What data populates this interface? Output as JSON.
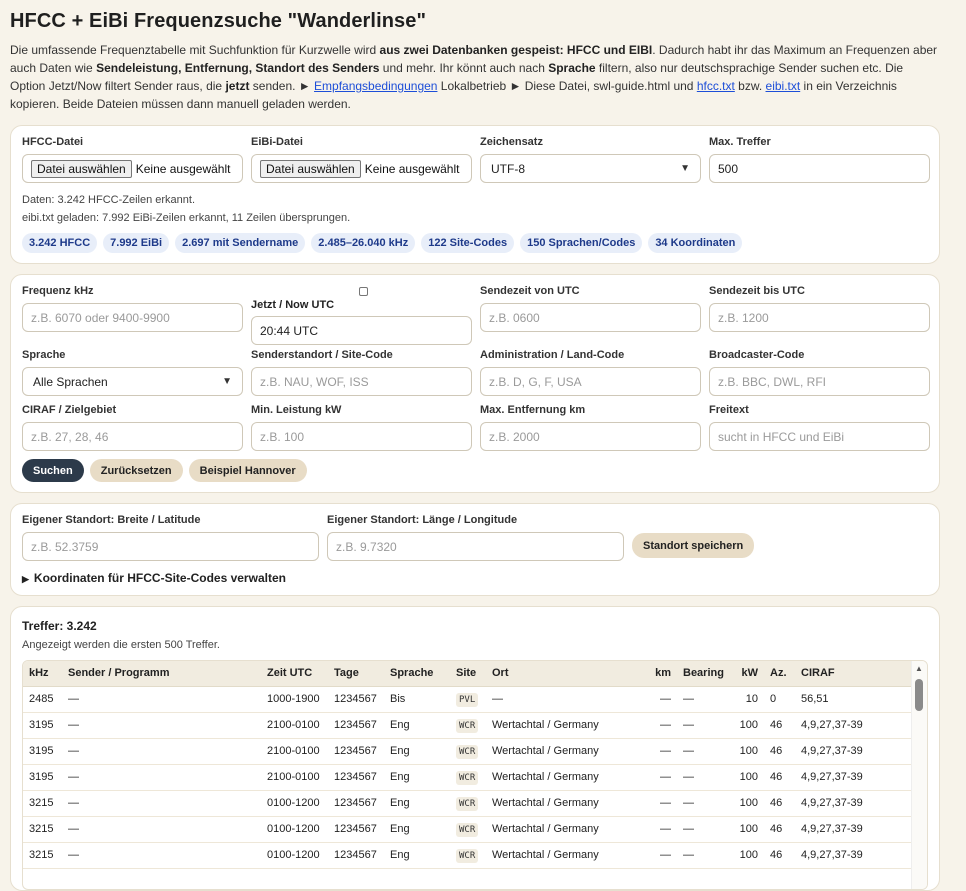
{
  "title": "HFCC + EiBi Frequenzsuche \"Wanderlinse\"",
  "intro": {
    "p1": "Die umfassende Frequenztabelle mit Suchfunktion für Kurzwelle wird ",
    "b1": "aus zwei Datenbanken gespeist: HFCC und EIBI",
    "p2": ". Dadurch habt ihr das Maximum an Frequenzen aber auch Daten wie ",
    "b2": "Sendeleistung, Entfernung, Standort des Senders",
    "p3": " und mehr. Ihr könnt auch nach ",
    "b3": "Sprache",
    "p4": " filtern, also nur deutschsprachige Sender suchen etc. Die Option Jetzt/Now filtert Sender raus, die ",
    "b4": "jetzt",
    "p5": " senden. ► ",
    "link1": "Empfangsbedingungen",
    "p6": " Lokalbetrieb ► Diese Datei, swl-guide.html und ",
    "link2": "hfcc.txt",
    "p7": " bzw. ",
    "link3": "eibi.txt",
    "p8": " in ein Verzeichnis kopieren. Beide Dateien müssen dann manuell geladen werden."
  },
  "files": {
    "hfcc_label": "HFCC-Datei",
    "eibi_label": "EiBi-Datei",
    "choose_btn": "Datei auswählen",
    "none_selected": "Keine ausgewählt",
    "charset_label": "Zeichensatz",
    "charset_value": "UTF-8",
    "max_label": "Max. Treffer",
    "max_value": "500",
    "status1": "Daten: 3.242 HFCC-Zeilen erkannt.",
    "status2": "eibi.txt geladen: 7.992 EiBi-Zeilen erkannt, 11 Zeilen übersprungen.",
    "chips": [
      "3.242 HFCC",
      "7.992 EiBi",
      "2.697 mit Sendername",
      "2.485–26.040 kHz",
      "122 Site-Codes",
      "150 Sprachen/Codes",
      "34 Koordinaten"
    ]
  },
  "filters": {
    "freq_label": "Frequenz kHz",
    "freq_ph": "z.B. 6070 oder 9400-9900",
    "now_label": "Jetzt / Now UTC",
    "now_value": "20:44 UTC",
    "from_label": "Sendezeit von UTC",
    "from_ph": "z.B. 0600",
    "to_label": "Sendezeit bis UTC",
    "to_ph": "z.B. 1200",
    "lang_label": "Sprache",
    "lang_value": "Alle Sprachen",
    "site_label": "Senderstandort / Site-Code",
    "site_ph": "z.B. NAU, WOF, ISS",
    "admin_label": "Administration / Land-Code",
    "admin_ph": "z.B. D, G, F, USA",
    "bc_label": "Broadcaster-Code",
    "bc_ph": "z.B. BBC, DWL, RFI",
    "ciraf_label": "CIRAF / Zielgebiet",
    "ciraf_ph": "z.B. 27, 28, 46",
    "power_label": "Min. Leistung kW",
    "power_ph": "z.B. 100",
    "dist_label": "Max. Entfernung km",
    "dist_ph": "z.B. 2000",
    "free_label": "Freitext",
    "free_ph": "sucht in HFCC und EiBi",
    "search_btn": "Suchen",
    "reset_btn": "Zurücksetzen",
    "example_btn": "Beispiel Hannover"
  },
  "location": {
    "lat_label": "Eigener Standort: Breite / Latitude",
    "lat_ph": "z.B. 52.3759",
    "lon_label": "Eigener Standort: Länge / Longitude",
    "lon_ph": "z.B. 9.7320",
    "save_btn": "Standort speichern",
    "coords_summary": "Koordinaten für HFCC-Site-Codes verwalten"
  },
  "results": {
    "title": "Treffer: 3.242",
    "subtitle": "Angezeigt werden die ersten 500 Treffer.",
    "headers": [
      "kHz",
      "Sender / Programm",
      "Zeit UTC",
      "Tage",
      "Sprache",
      "Site",
      "Ort",
      "km",
      "Bearing",
      "kW",
      "Az.",
      "CIRAF"
    ],
    "rows": [
      [
        "2485",
        "—",
        "1000-1900",
        "1234567",
        "Bis",
        "PVL",
        "—",
        "—",
        "—",
        "10",
        "0",
        "56,51"
      ],
      [
        "3195",
        "—",
        "2100-0100",
        "1234567",
        "Eng",
        "WCR",
        "Wertachtal / Germany",
        "—",
        "—",
        "100",
        "46",
        "4,9,27,37-39"
      ],
      [
        "3195",
        "—",
        "2100-0100",
        "1234567",
        "Eng",
        "WCR",
        "Wertachtal / Germany",
        "—",
        "—",
        "100",
        "46",
        "4,9,27,37-39"
      ],
      [
        "3195",
        "—",
        "2100-0100",
        "1234567",
        "Eng",
        "WCR",
        "Wertachtal / Germany",
        "—",
        "—",
        "100",
        "46",
        "4,9,27,37-39"
      ],
      [
        "3215",
        "—",
        "0100-1200",
        "1234567",
        "Eng",
        "WCR",
        "Wertachtal / Germany",
        "—",
        "—",
        "100",
        "46",
        "4,9,27,37-39"
      ],
      [
        "3215",
        "—",
        "0100-1200",
        "1234567",
        "Eng",
        "WCR",
        "Wertachtal / Germany",
        "—",
        "—",
        "100",
        "46",
        "4,9,27,37-39"
      ],
      [
        "3215",
        "—",
        "0100-1200",
        "1234567",
        "Eng",
        "WCR",
        "Wertachtal / Germany",
        "—",
        "—",
        "100",
        "46",
        "4,9,27,37-39"
      ],
      [
        "",
        "",
        "",
        "",
        "",
        "",
        "",
        "",
        "",
        "",
        "",
        ""
      ]
    ]
  }
}
